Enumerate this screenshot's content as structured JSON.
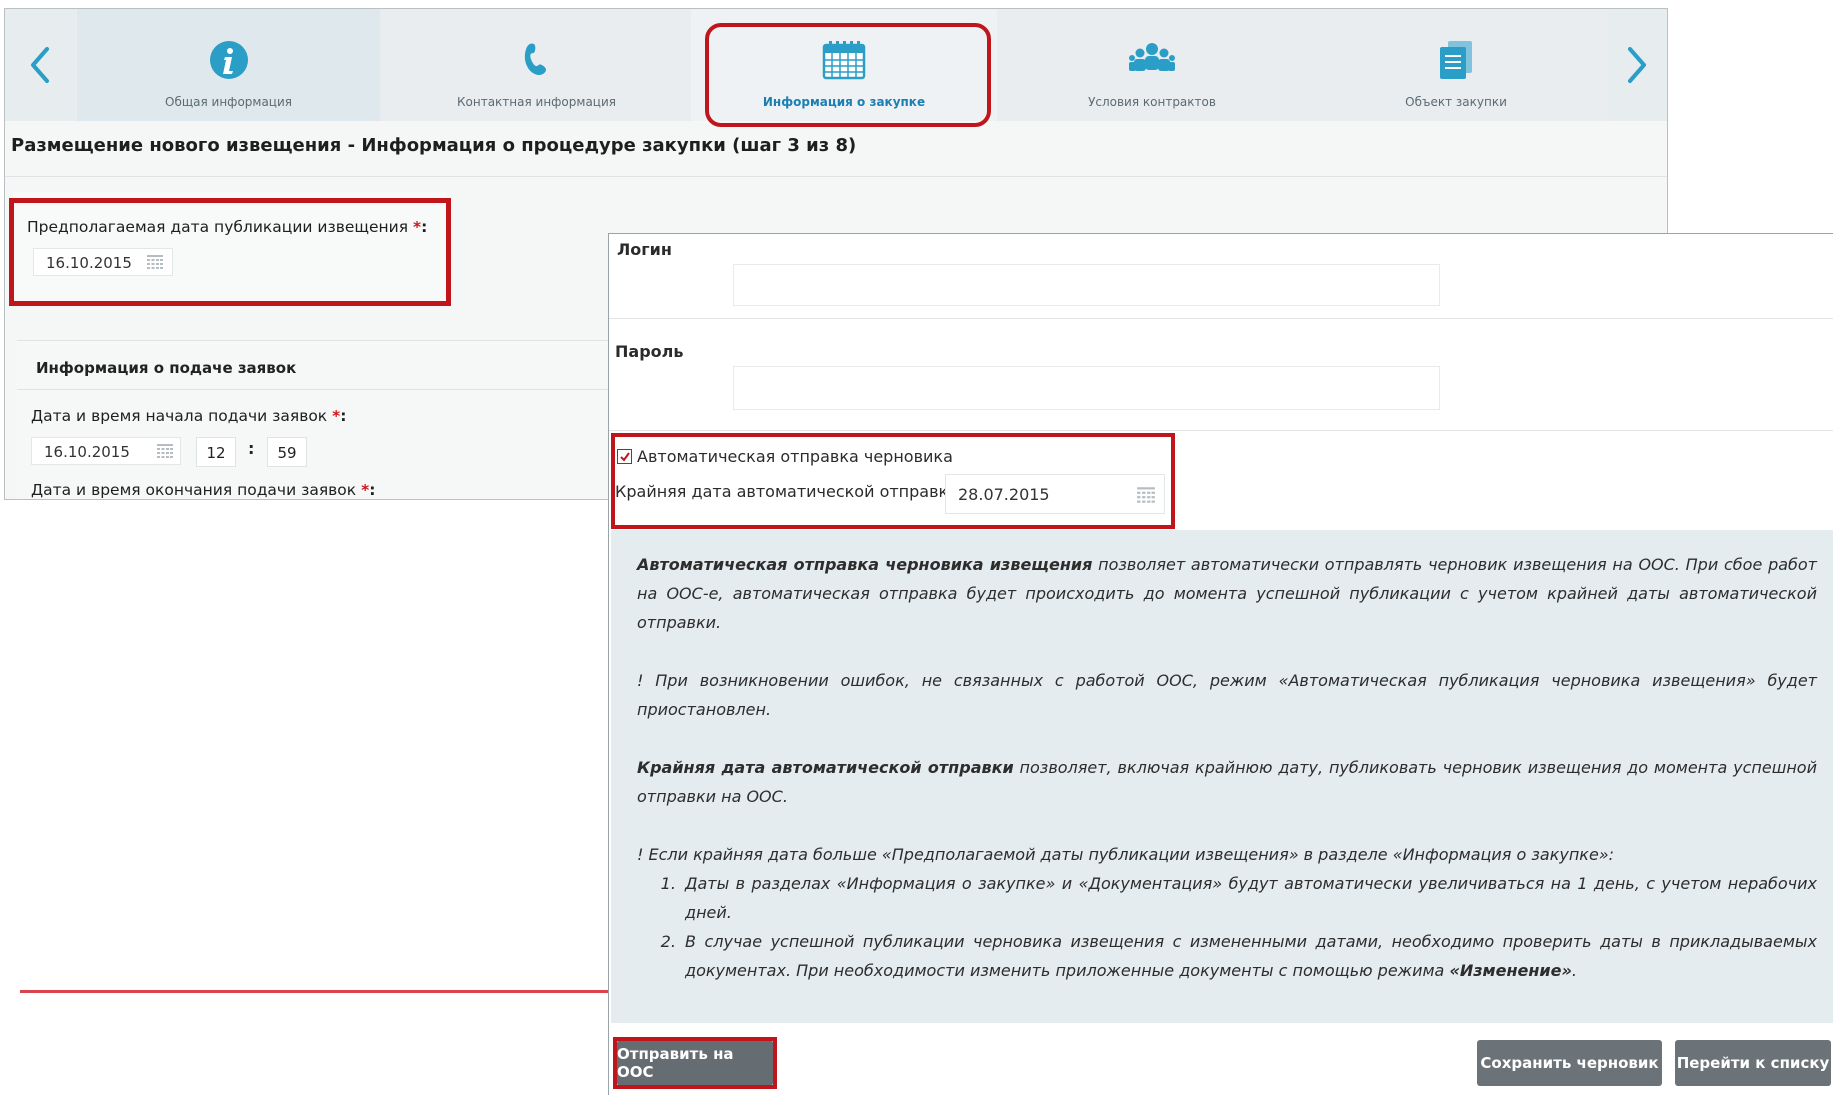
{
  "tabs": [
    {
      "label": "Общая информация",
      "icon": "info-icon"
    },
    {
      "label": "Контактная информация",
      "icon": "phone-icon"
    },
    {
      "label": "Информация о закупке",
      "icon": "calendar-icon",
      "active": true
    },
    {
      "label": "Условия контрактов",
      "icon": "people-icon"
    },
    {
      "label": "Объект закупки",
      "icon": "documents-icon"
    }
  ],
  "page_title": "Размещение нового извещения - Информация о процедуре закупки (шаг 3 из 8)",
  "publication": {
    "label": "Предполагаемая дата публикации извещения",
    "required_mark": "*",
    "colon": ":",
    "date": "16.10.2015"
  },
  "applications": {
    "heading": "Информация о подаче заявок",
    "start_label": "Дата и время начала подачи заявок",
    "start_date": "16.10.2015",
    "start_hour": "12",
    "start_minute": "59",
    "end_label": "Дата и время окончания подачи заявок",
    "required_mark": "*",
    "colon": ":",
    "time_sep": ":"
  },
  "dialog": {
    "login_label": "Логин",
    "login_value": "",
    "password_label": "Пароль",
    "password_value": "",
    "auto_send_label": "Автоматическая отправка черновика",
    "auto_send_checked": true,
    "deadline_label": "Крайняя дата автоматической отправки:",
    "deadline_date": "28.07.2015",
    "info": {
      "p1_bold": "Автоматическая отправка черновика извещения",
      "p1_rest": " позволяет автоматически отправлять черновик извещения на ООС. При сбое работ на ООС-е, автоматическая отправка будет происходить до момента успешной публикации с учетом крайней даты автоматической отправки.",
      "p2": "! При возникновении ошибок, не связанных с работой ООС, режим «Автоматическая публикация черновика извещения» будет приостановлен.",
      "p3_bold": "Крайняя дата автоматической отправки",
      "p3_rest": " позволяет, включая крайнюю дату, публиковать черновик извещения до момента успешной отправки на ООС.",
      "p4": "! Если крайняя дата больше «Предполагаемой даты публикации извещения» в разделе «Информация о закупке»:",
      "li1": "Даты в разделах «Информация о закупке» и «Документация» будут автоматически увеличиваться на 1 день, с учетом нерабочих дней.",
      "li2_a": "В случае успешной публикации черновика извещения с измененными датами, необходимо проверить даты в прикладываемых документах. При необходимости изменить приложенные документы с помощью режима ",
      "li2_b": "«Изменение»",
      "li2_c": "."
    },
    "buttons": {
      "send": "Отправить на ООС",
      "save": "Сохранить черновик",
      "list": "Перейти к списку"
    }
  },
  "colors": {
    "accent": "#2a9ec7",
    "highlight": "#c0161b",
    "button": "#6b7378",
    "info_bg": "#e4ecef"
  }
}
